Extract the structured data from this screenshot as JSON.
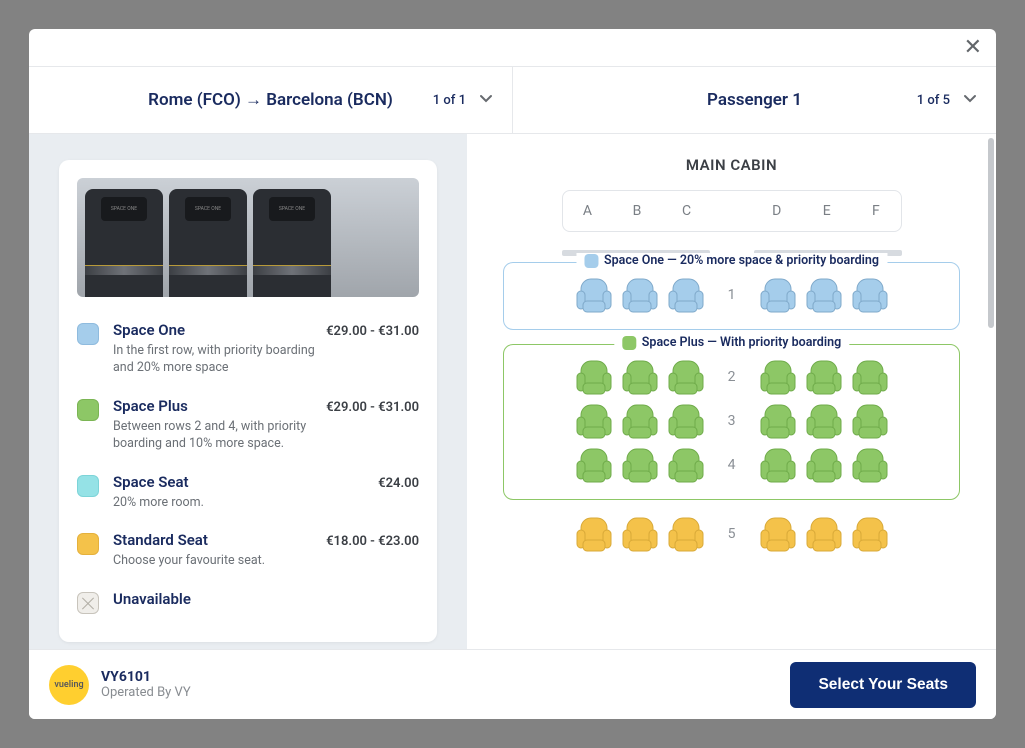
{
  "header": {
    "route": "Rome (FCO) → Barcelona (BCN)",
    "route_count": "1 of 1",
    "passenger": "Passenger 1",
    "passenger_count": "1 of 5"
  },
  "legend": {
    "items": [
      {
        "key": "space_one",
        "name": "Space One",
        "price": "€29.00 - €31.00",
        "desc": "In the first row, with priority boarding and 20% more space",
        "swatch": "sw-spaceone"
      },
      {
        "key": "space_plus",
        "name": "Space Plus",
        "price": "€29.00 - €31.00",
        "desc": "Between rows 2 and 4, with priority boarding and 10% more space.",
        "swatch": "sw-spaceplus"
      },
      {
        "key": "space_seat",
        "name": "Space Seat",
        "price": "€24.00",
        "desc": "20% more room.",
        "swatch": "sw-spaceseat"
      },
      {
        "key": "standard",
        "name": "Standard Seat",
        "price": "€18.00 - €23.00",
        "desc": "Choose your favourite seat.",
        "swatch": "sw-standard"
      },
      {
        "key": "unavailable",
        "name": "Unavailable",
        "price": "",
        "desc": "",
        "swatch": "sw-unavail"
      }
    ]
  },
  "cabin": {
    "title": "MAIN CABIN",
    "columns_left": [
      "A",
      "B",
      "C"
    ],
    "columns_right": [
      "D",
      "E",
      "F"
    ],
    "zones": [
      {
        "key": "space_one",
        "label": "Space One — 20% more space & priority boarding",
        "rows": [
          "1"
        ],
        "seat_fill": "#a5cdeb",
        "seat_stroke": "#7fa9ca",
        "css": "zone-spaceone"
      },
      {
        "key": "space_plus",
        "label": "Space Plus — With priority boarding",
        "rows": [
          "2",
          "3",
          "4"
        ],
        "seat_fill": "#8dc766",
        "seat_stroke": "#6fab4a",
        "css": "zone-spaceplus"
      }
    ],
    "loose_rows": [
      {
        "row": "5",
        "seat_fill": "#f4c24a",
        "seat_stroke": "#d8a938"
      }
    ]
  },
  "footer": {
    "brand": "vueling",
    "flight": "VY6101",
    "operated": "Operated By VY",
    "cta": "Select Your Seats"
  }
}
